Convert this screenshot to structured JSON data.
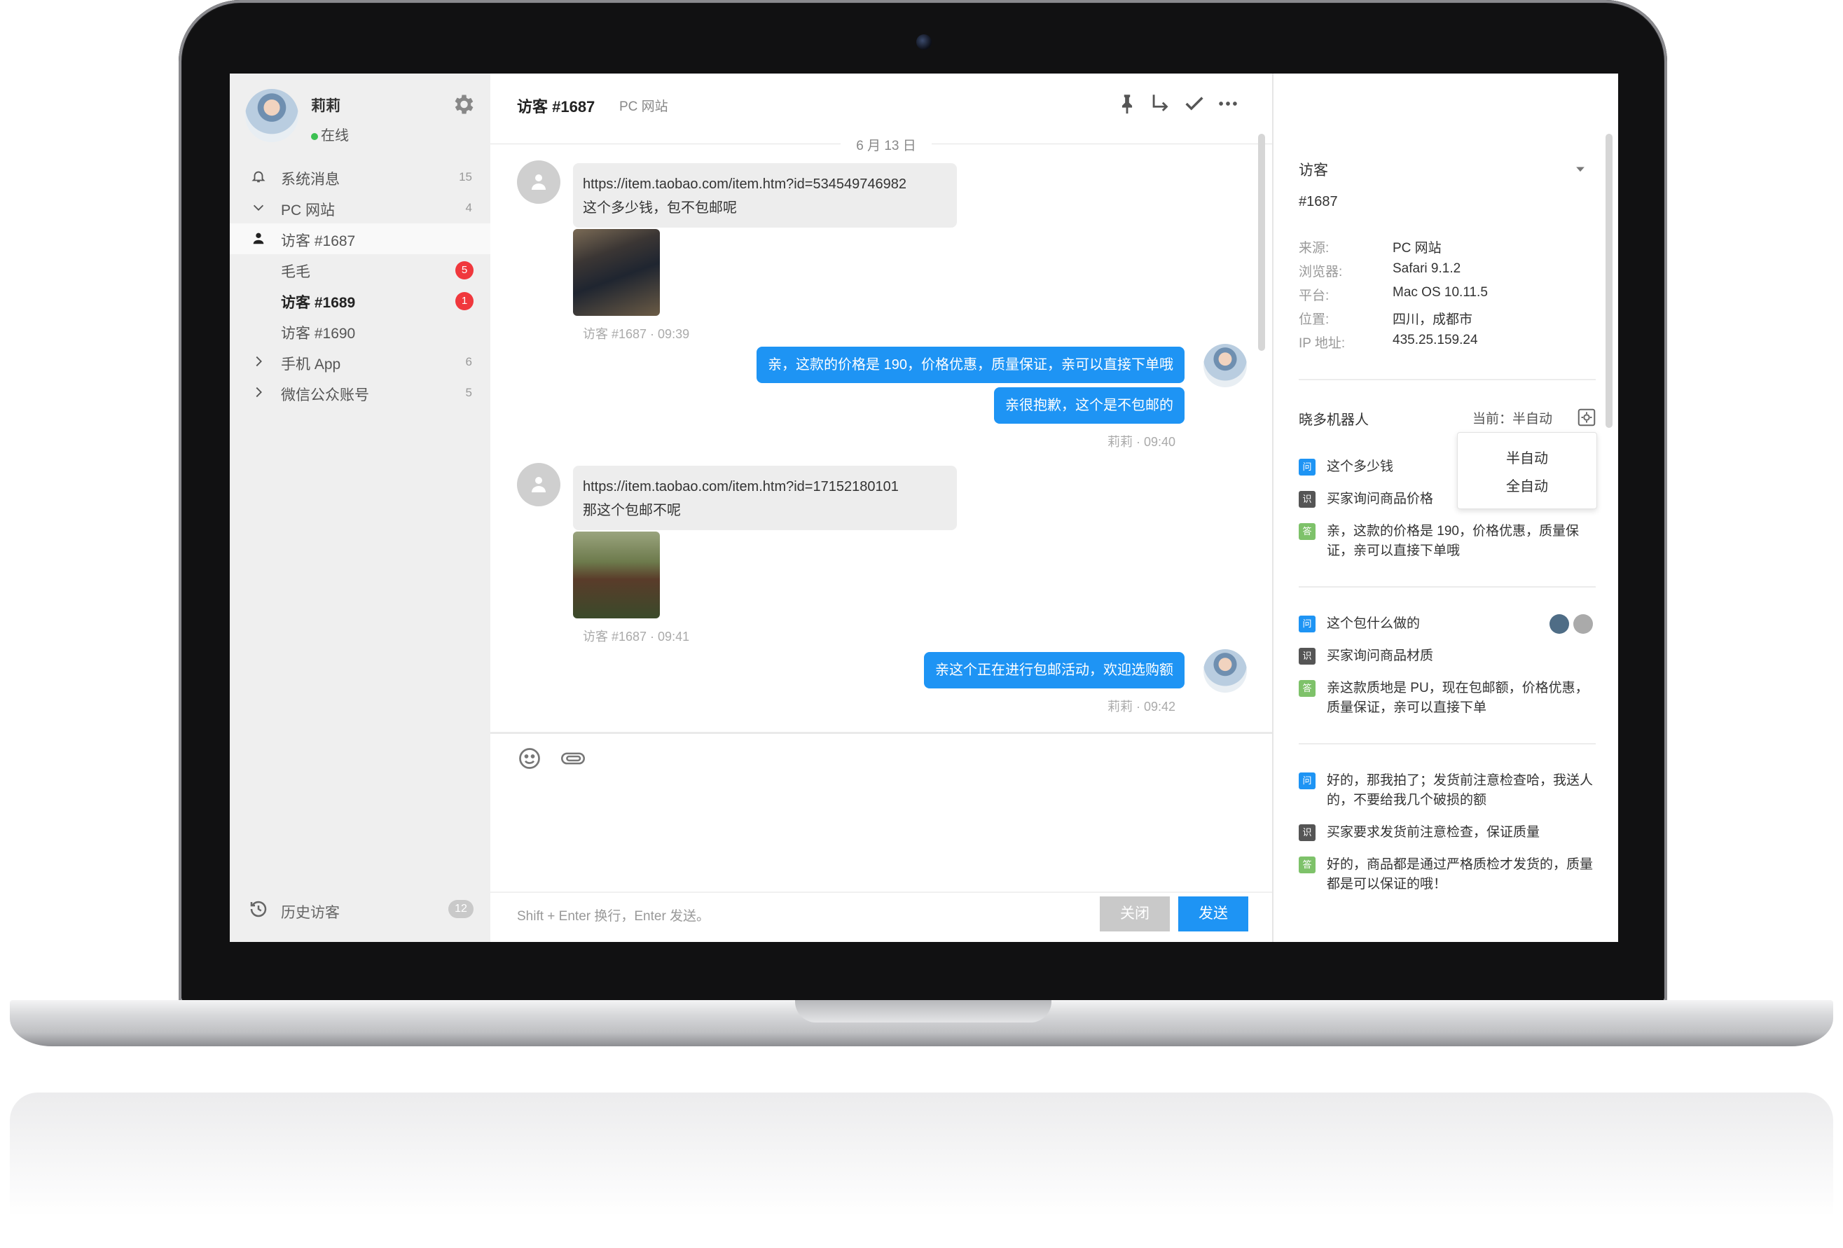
{
  "me": {
    "name": "莉莉",
    "status": "在线"
  },
  "sidebar": {
    "items": [
      {
        "label": "系统消息",
        "count": "15"
      },
      {
        "label": "PC 网站",
        "count": "4"
      },
      {
        "label": "访客 #1687"
      },
      {
        "label": "毛毛",
        "badge": "5"
      },
      {
        "label": "访客 #1689",
        "badge": "1"
      },
      {
        "label": "访客 #1690"
      },
      {
        "label": "手机 App",
        "count": "6"
      },
      {
        "label": "微信公众账号",
        "count": "5"
      }
    ],
    "history": {
      "label": "历史访客",
      "count": "12"
    }
  },
  "chat": {
    "title": "访客 #1687",
    "source": "PC 网站",
    "date": "6 月 13 日",
    "messages": [
      {
        "line1": "https://item.taobao.com/item.htm?id=534549746982",
        "line2": "这个多少钱，包不包邮呢",
        "meta": "访客 #1687 · 09:39"
      },
      {
        "text": "亲，这款的价格是 190，价格优惠，质量保证，亲可以直接下单哦"
      },
      {
        "text": "亲很抱歉，这个是不包邮的",
        "meta": "莉莉 · 09:40"
      },
      {
        "line1": "https://item.taobao.com/item.htm?id=17152180101",
        "line2": "那这个包邮不呢",
        "meta": "访客 #1687 · 09:41"
      },
      {
        "text": "亲这个正在进行包邮活动，欢迎选购额",
        "meta": "莉莉 · 09:42"
      }
    ],
    "hint": "Shift + Enter 换行，Enter 发送。",
    "close_label": "关闭",
    "send_label": "发送"
  },
  "panel": {
    "visitor_title": "访客",
    "visitor_id": "#1687",
    "fields": [
      {
        "key": "来源:",
        "value": "PC 网站"
      },
      {
        "key": "浏览器:",
        "value": "Safari 9.1.2"
      },
      {
        "key": "平台:",
        "value": "Mac OS 10.11.5"
      },
      {
        "key": "位置:",
        "value": "四川，成都市"
      },
      {
        "key": "IP 地址:",
        "value": "435.25.159.24"
      }
    ],
    "robot_title": "晓多机器人",
    "robot_mode": "当前：半自动",
    "mode_options": [
      "半自动",
      "全自动"
    ],
    "tags": {
      "q": "问",
      "i": "识",
      "a": "答"
    },
    "qa_groups": [
      {
        "q": "这个多少钱",
        "i": "买家询问商品价格",
        "a": "亲，这款的价格是 190，价格优惠，质量保证，亲可以直接下单哦"
      },
      {
        "q": "这个包什么做的",
        "i": "买家询问商品材质",
        "a": "亲这款质地是 PU，现在包邮额，价格优惠，质量保证，亲可以直接下单"
      },
      {
        "q": "好的，那我拍了；发货前注意检查哈，我送人的，不要给我几个破损的额",
        "i": "买家要求发货前注意检查，保证质量",
        "a": "好的，商品都是通过严格质检才发货的，质量都是可以保证的哦！"
      }
    ]
  },
  "colors": {
    "accent": "#1e94f4",
    "badge": "#f0383d",
    "online": "#3cc051"
  },
  "icons": [
    "gear-icon",
    "bell-icon",
    "chevron-down-icon",
    "user-icon",
    "chevron-right-icon",
    "history-icon",
    "pin-icon",
    "forward-icon",
    "check-icon",
    "more-icon",
    "emoji-icon",
    "attach-icon",
    "caret-down-icon",
    "settings-icon"
  ]
}
